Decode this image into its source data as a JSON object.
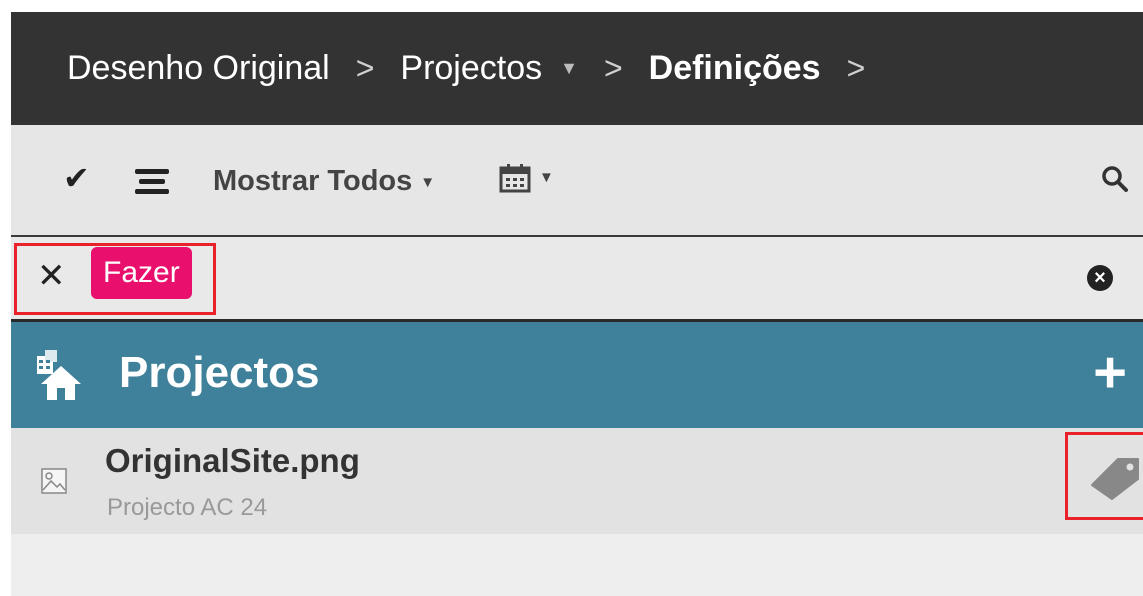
{
  "breadcrumb": {
    "items": [
      {
        "label": "Desenho Original",
        "has_dropdown": false
      },
      {
        "label": "Projectos",
        "has_dropdown": true
      },
      {
        "label": "Definições",
        "has_dropdown": false
      }
    ],
    "separator": ">"
  },
  "toolbar": {
    "select_icon": "checkmark-icon",
    "menu_icon": "list-icon",
    "filter_label": "Mostrar Todos",
    "calendar_icon": "calendar-icon",
    "search_icon": "search-icon"
  },
  "tag_filter": {
    "remove_icon": "close-icon",
    "tag_label": "Fazer",
    "tag_color": "#e8106c",
    "clear_icon": "clear-circle-icon"
  },
  "section": {
    "title": "Projectos",
    "icon": "projects-house-icon",
    "add_icon": "plus-icon",
    "color": "#3f809b"
  },
  "files": [
    {
      "name": "OriginalSite.png",
      "project": "Projecto AC 24",
      "icon": "image-file-icon",
      "action_icon": "tag-icon"
    }
  ],
  "colors": {
    "header_bg": "#333333",
    "highlight": "#e8212a"
  }
}
